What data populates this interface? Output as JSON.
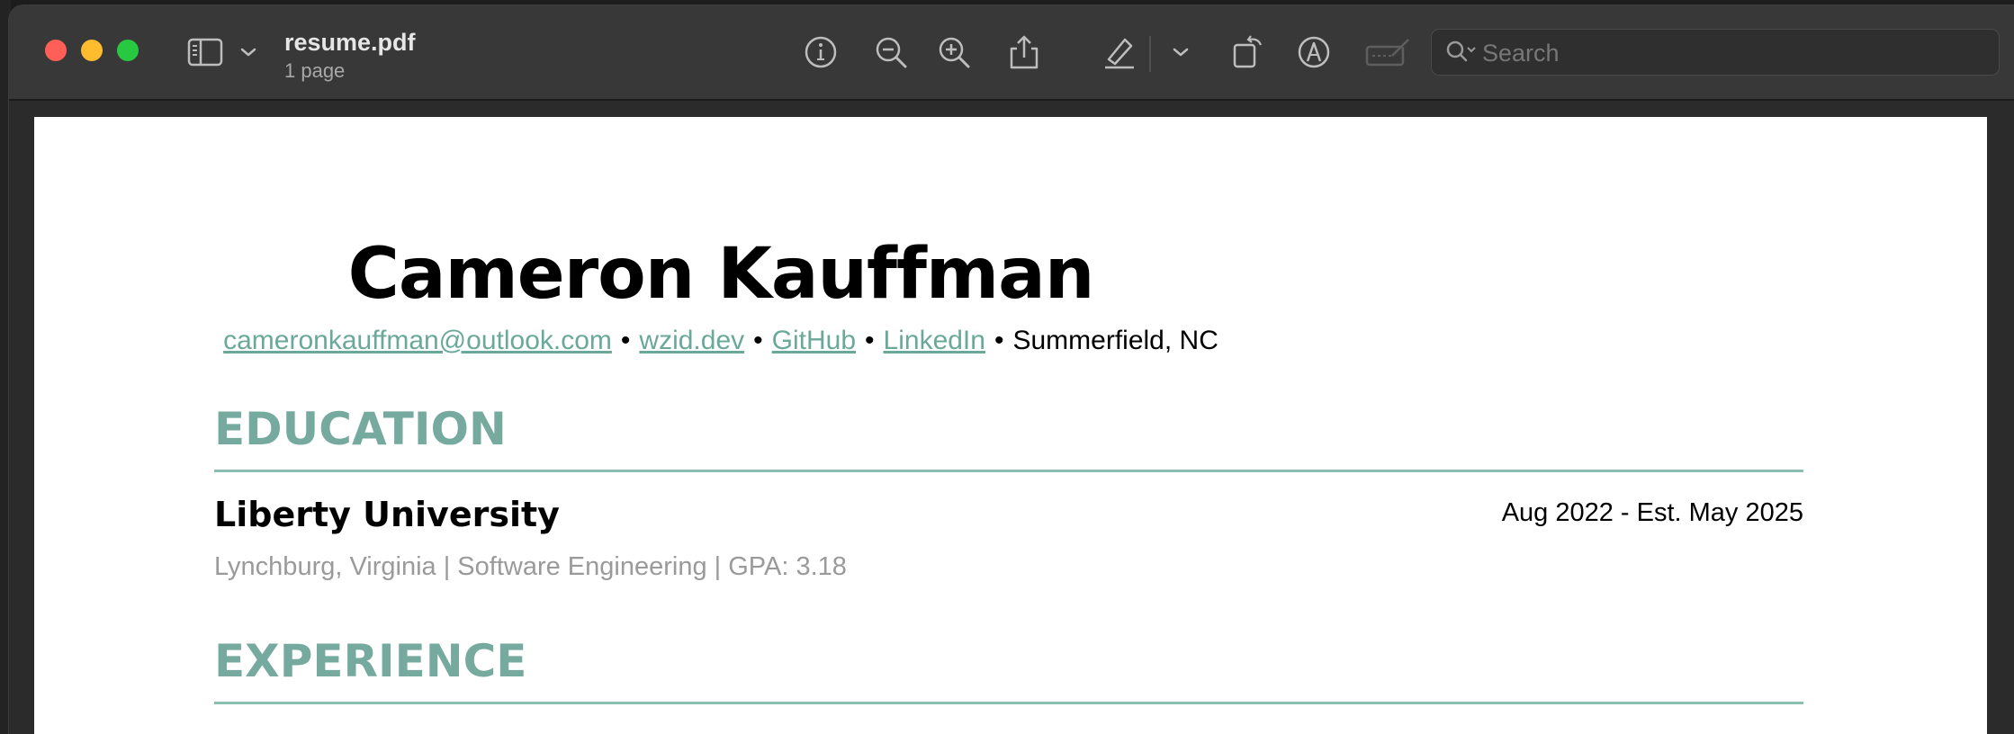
{
  "window": {
    "title": "resume.pdf",
    "subtitle": "1 page"
  },
  "toolbar": {
    "icons": [
      "sidebar-icon",
      "chevron-down-icon",
      "info-icon",
      "zoom-out-icon",
      "zoom-in-icon",
      "share-icon",
      "highlight-pen-icon",
      "chevron-down-icon",
      "rotate-icon",
      "markup-icon",
      "sign-icon"
    ],
    "search_placeholder": "Search"
  },
  "document": {
    "name": "Cameron Kauffman",
    "contact": {
      "email": "cameronkauffman@outlook.com",
      "website": "wzid.dev",
      "github": "GitHub",
      "linkedin": "LinkedIn",
      "location": "Summerfield, NC",
      "separator": "•"
    },
    "sections": {
      "education_heading": "EDUCATION",
      "experience_heading": "EXPERIENCE"
    },
    "education": {
      "school": "Liberty University",
      "dates": "Aug 2022 - Est. May 2025",
      "detail": "Lynchburg, Virginia | Software Engineering | GPA: 3.18"
    }
  },
  "colors": {
    "accent": "#77aa9f",
    "link": "#6aa99a",
    "toolbar_bg": "#383838"
  }
}
